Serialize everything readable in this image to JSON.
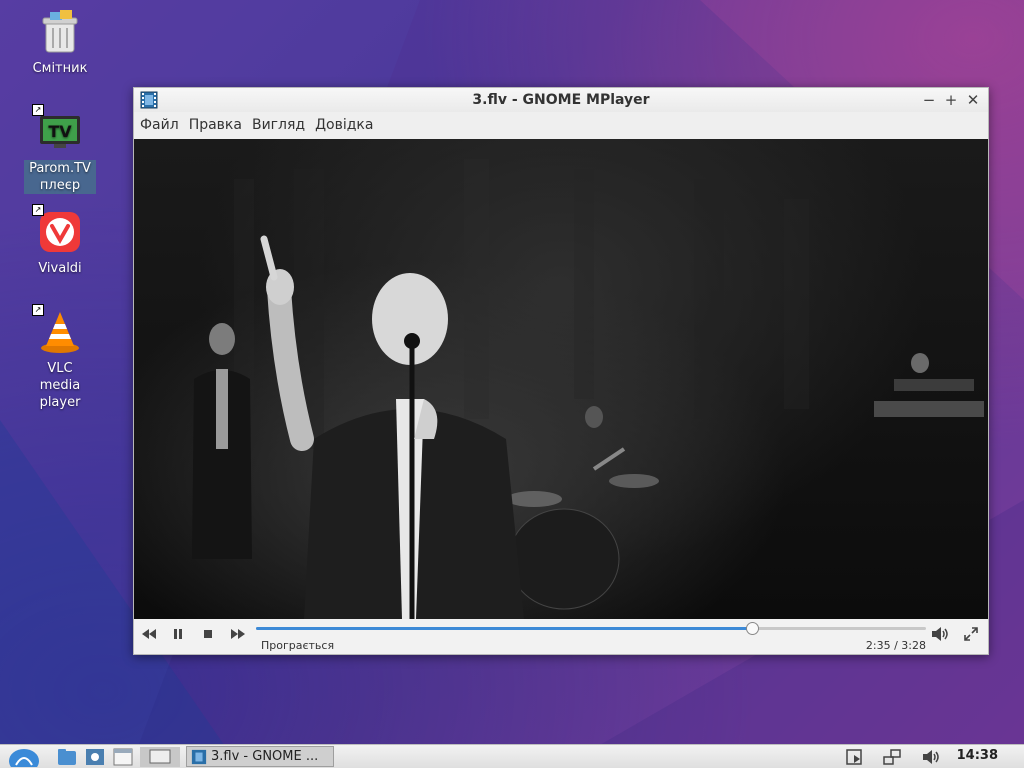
{
  "desktop": {
    "icons": [
      {
        "label": "Смітник",
        "icon": "trash-icon"
      },
      {
        "label": "Parom.TV плеєр",
        "icon": "tv-icon"
      },
      {
        "label": "Vivaldi",
        "icon": "vivaldi-icon"
      },
      {
        "label": "VLC media player",
        "icon": "vlc-icon"
      }
    ]
  },
  "window": {
    "title": "3.flv - GNOME MPlayer",
    "menu": [
      "Файл",
      "Правка",
      "Вигляд",
      "Довідка"
    ],
    "controls": {
      "status": "Програється",
      "time": "2:35 /  3:28",
      "progress": 0.74
    }
  },
  "taskbar": {
    "task_label": "3.flv - GNOME ...",
    "clock": "14:38"
  },
  "colors": {
    "accent": "#3d8ad7",
    "selection": "#466e8c"
  }
}
